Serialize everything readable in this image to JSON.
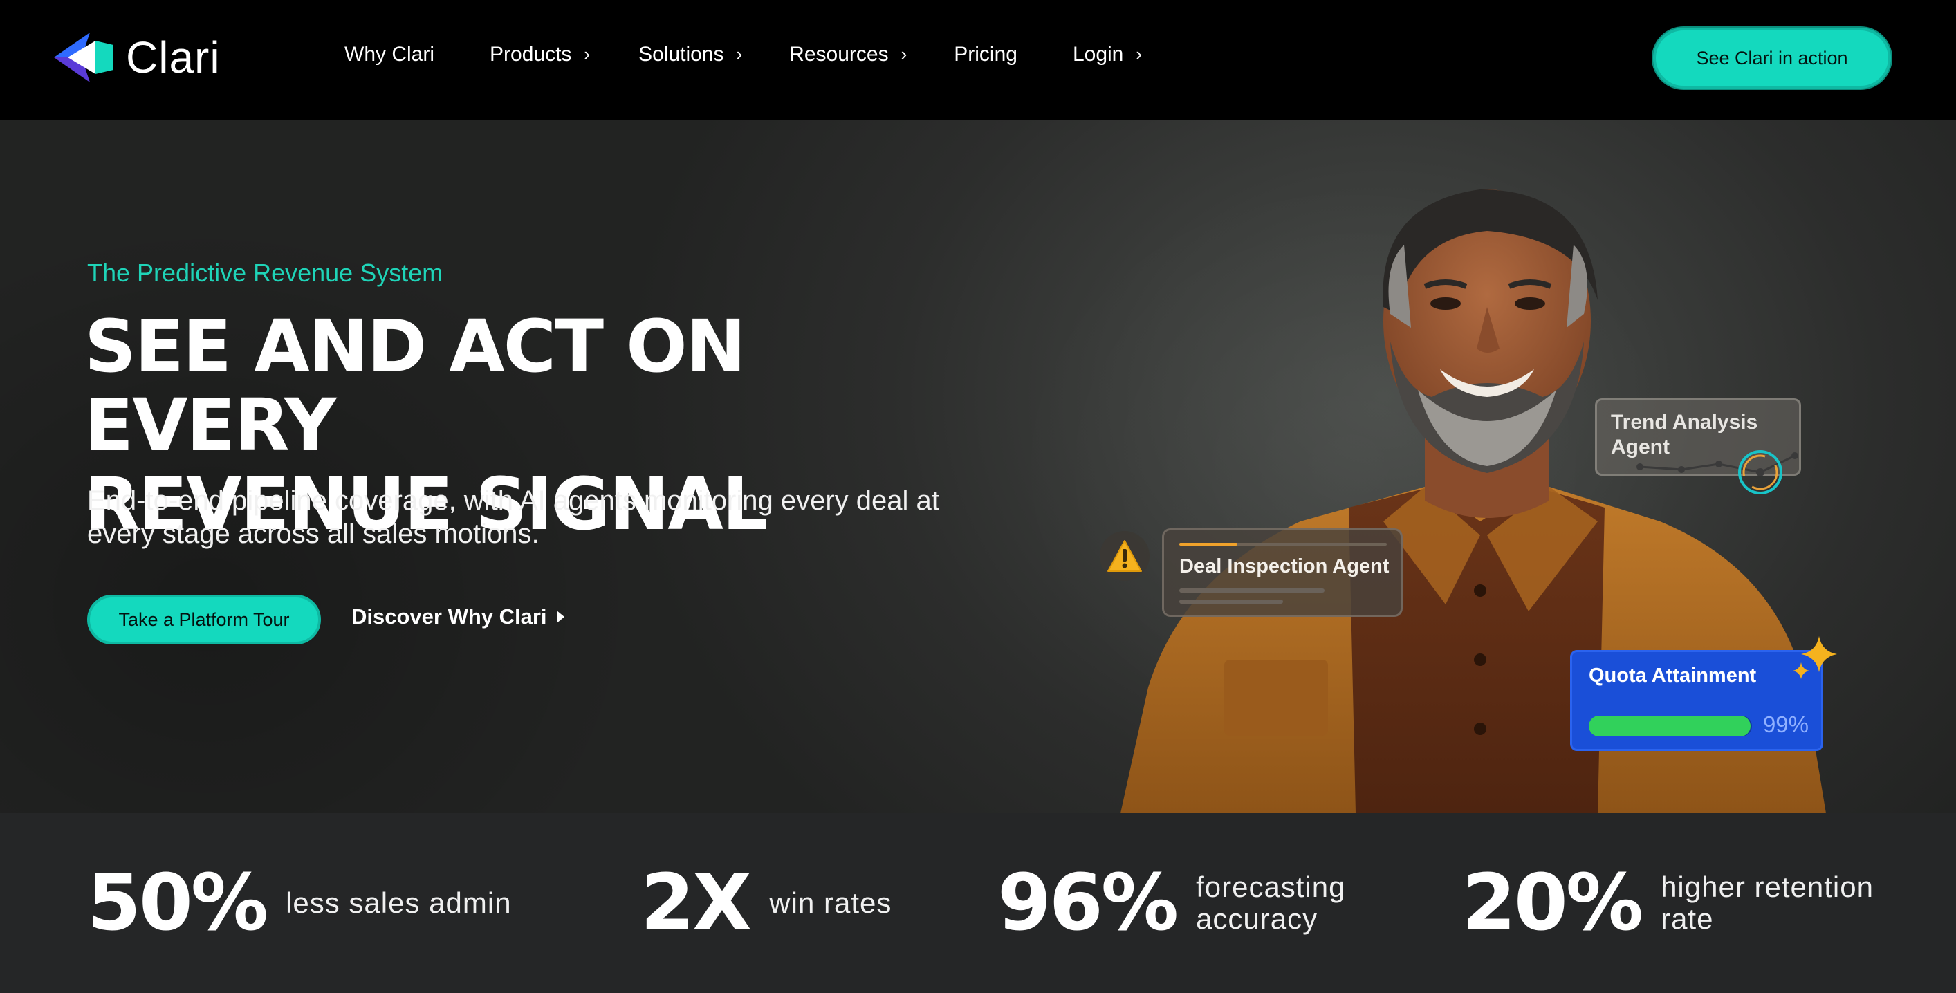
{
  "brand": {
    "name": "Clari",
    "accent": "#14d9be"
  },
  "nav": {
    "items": [
      {
        "label": "Why Clari",
        "has_chevron": false
      },
      {
        "label": "Products",
        "has_chevron": true
      },
      {
        "label": "Solutions",
        "has_chevron": true
      },
      {
        "label": "Resources",
        "has_chevron": true
      },
      {
        "label": "Pricing",
        "has_chevron": false
      },
      {
        "label": "Login",
        "has_chevron": true
      }
    ],
    "cta_label": "See Clari in action"
  },
  "hero": {
    "eyebrow": "The Predictive Revenue System",
    "headline_line1": "SEE AND ACT ON EVERY",
    "headline_line2": "REVENUE SIGNAL",
    "subhead": "End-to-end pipeline coverage, with AI agents monitoring every deal at every stage across all sales motions.",
    "primary_button": "Take a Platform Tour",
    "secondary_link": "Discover Why Clari"
  },
  "cards": {
    "deal_inspection": {
      "label": "Deal Inspection Agent",
      "icon": "warning-icon"
    },
    "trend_analysis": {
      "label_line1": "Trend Analysis",
      "label_line2": "Agent"
    },
    "quota": {
      "label": "Quota Attainment",
      "value_text": "99%",
      "progress": 0.99
    }
  },
  "stats": [
    {
      "value": "50%",
      "text_line1": "less sales admin",
      "text_line2": ""
    },
    {
      "value": "2X",
      "text_line1": "win rates",
      "text_line2": ""
    },
    {
      "value": "96%",
      "text_line1": "forecasting",
      "text_line2": "accuracy"
    },
    {
      "value": "20%",
      "text_line1": "higher retention",
      "text_line2": "rate"
    }
  ]
}
